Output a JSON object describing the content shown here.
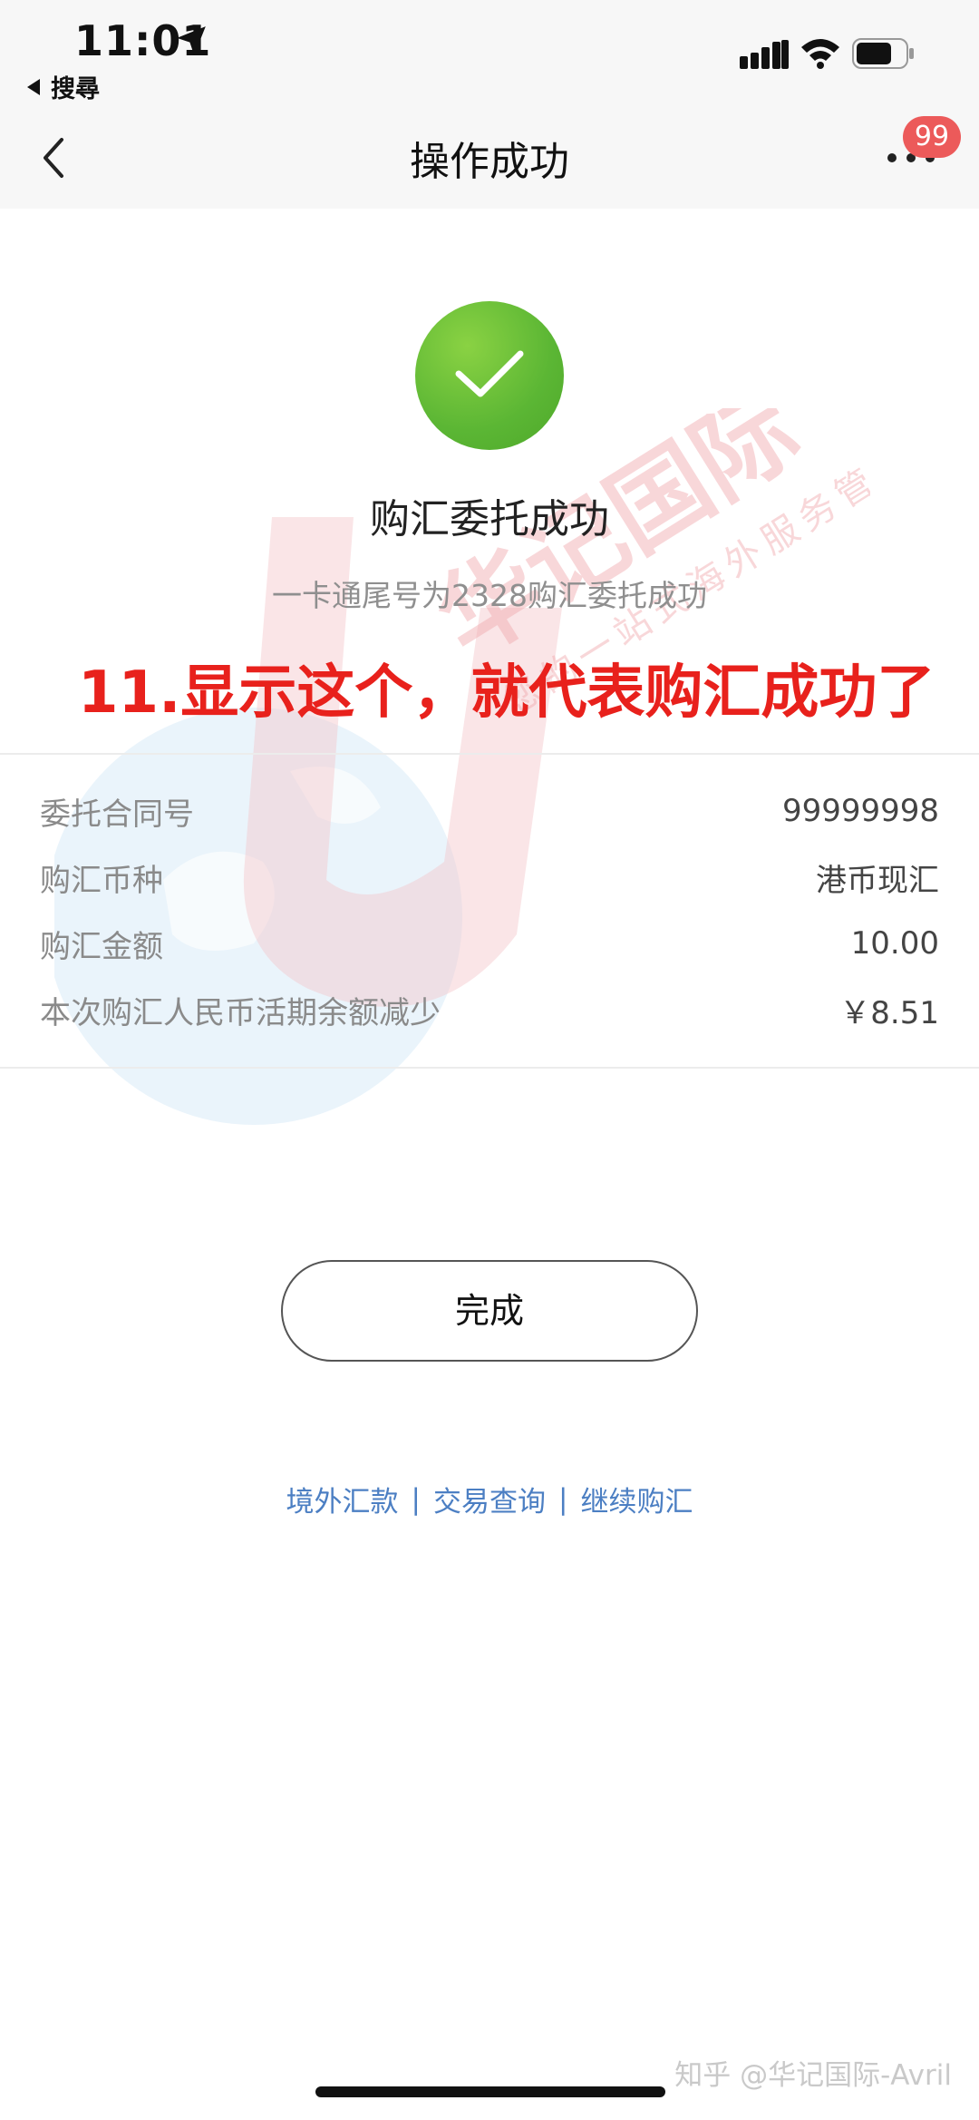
{
  "status_bar": {
    "time": "11:01",
    "back_app_label": "搜尋"
  },
  "nav": {
    "title": "操作成功",
    "badge_count": "99"
  },
  "success": {
    "title": "购汇委托成功",
    "subtitle": "一卡通尾号为2328购汇委托成功"
  },
  "annotation": "11.显示这个，就代表购汇成功了",
  "details": [
    {
      "label": "委托合同号",
      "value": "99999998"
    },
    {
      "label": "购汇币种",
      "value": "港币现汇"
    },
    {
      "label": "购汇金额",
      "value": "10.00"
    },
    {
      "label": "本次购汇人民币活期余额减少",
      "value": "￥8.51"
    }
  ],
  "done_button": "完成",
  "links": [
    {
      "label": "境外汇款"
    },
    {
      "label": "交易查询"
    },
    {
      "label": "继续购汇"
    }
  ],
  "link_separator": "|",
  "watermark": {
    "brand": "华记国际",
    "tagline": "您的一站式海外服务管家",
    "footer": "知乎 @华记国际-Avril"
  },
  "colors": {
    "success_green": "#5bb634",
    "annotation_red": "#e8211c",
    "link_blue": "#4c7fc3",
    "badge_red": "#ec5a5a"
  }
}
